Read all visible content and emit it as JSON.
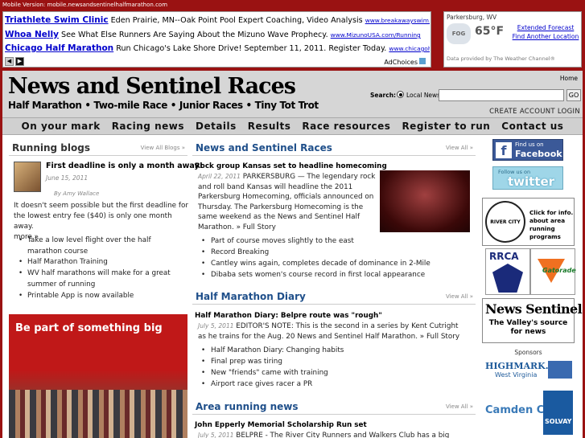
{
  "mobile_bar": "Mobile Version: mobile.newsandsentinelhalfmarathon.com",
  "ads": [
    {
      "title": "Triathlete Swim Clinic",
      "text": " Eden Prairie, MN--Oak Point Pool Expert Coaching, Video Analysis ",
      "url": "www.breakawayswim.com"
    },
    {
      "title": "Whoa Nelly",
      "text": " See What Else Runners Are Saying About the Mizuno Wave Prophecy. ",
      "url": "www.MizunoUSA.com/Running"
    },
    {
      "title": "Chicago Half Marathon",
      "text": " Run Chicago's Lake Shore Drive! September 11, 2011. Register Today. ",
      "url": "www.chicagohalfmarathon.com"
    }
  ],
  "ad_choices": "AdChoices",
  "weather": {
    "location": "Parkersburg, WV",
    "condition": "FOG",
    "temp": "65°F",
    "link1": "Extended Forecast",
    "link2": "Find Another Location",
    "source": "Data provided by The Weather Channel®"
  },
  "header": {
    "logo_title": "News and Sentinel Races",
    "logo_sub": "Half Marathon • Two-mile Race • Junior Races • Tiny Tot Trot",
    "home": "Home",
    "search_label": "Search:",
    "search_option": "Local News",
    "go": "GO",
    "account": "CREATE ACCOUNT  LOGIN"
  },
  "nav": [
    "On your mark",
    "Racing news",
    "Details",
    "Results",
    "Race resources",
    "Register to run",
    "Contact us"
  ],
  "blogs": {
    "heading": "Running blogs",
    "view_all": "View All Blogs »",
    "post_title": "First deadline is only a month away!",
    "post_date": "June 15, 2011",
    "post_author": "By Amy Wallace",
    "post_text": "It doesn't seem possible but the first deadline for the lowest entry fee ($40) is only one month away.",
    "more": "more »",
    "list": [
      "Take a low level flight over the half marathon course",
      "Half Marathon Training",
      "WV half marathons will make for a great summer of running",
      "Printable App is now available"
    ],
    "promo": "Be part of something big"
  },
  "news": {
    "heading": "News and Sentinel Races",
    "view_all": "View All »",
    "lead_title": "Rock group Kansas set to headline homecoming",
    "lead_date": "April 22, 2011",
    "lead_text": "PARKERSBURG — The legendary rock and roll band Kansas will headline the 2011 Parkersburg Homecoming, officials announced on Thursday. The Parkersburg Homecoming is the same weekend as the News and Sentinel Half Marathon.",
    "lead_link": "» Full Story",
    "list": [
      "Part of course moves slightly to the east",
      "Record Breaking",
      "Cantley wins again, completes decade of dominance in 2-Mile",
      "Dibaba sets women's course record in first local appearance"
    ]
  },
  "diary": {
    "heading": "Half Marathon Diary",
    "view_all": "View All »",
    "lead_title": "Half Marathon Diary: Belpre route was \"rough\"",
    "lead_date": "July 5, 2011",
    "lead_text": "EDITOR'S NOTE: This is the second in a series by Kent Cutright as he trains for the Aug. 20 News and Sentinel Half Marathon. » Full Story",
    "list": [
      "Half Marathon Diary: Changing habits",
      "Final prep was tiring",
      "New \"friends\" came with training",
      "Airport race gives racer a PR"
    ]
  },
  "area": {
    "heading": "Area running news",
    "view_all": "View All »",
    "lead_title": "John Epperly Memorial Scholarship Run set",
    "lead_date": "July 5, 2011",
    "lead_text": "BELPRE - The River City Runners and Walkers Club has a big"
  },
  "sidebar": {
    "fb_top": "Find us on",
    "fb_main": "Facebook",
    "tw_top": "Follow us on",
    "tw_main": "twitter",
    "rcr_emblem": "RIVER CITY RUNNERS",
    "rcr_text": "Click for info. about area running programs",
    "rrca": "RRCA",
    "gatorade": "Gatorade",
    "nsr_title": "News Sentinel",
    "nsr_tagline": "The Valley's source for news",
    "sponsors": "Sponsors",
    "highmark": "HIGHMARK.",
    "highmark_sub": "West Virginia",
    "camden": "Camden Clark",
    "solvay": "SOLVAY"
  }
}
